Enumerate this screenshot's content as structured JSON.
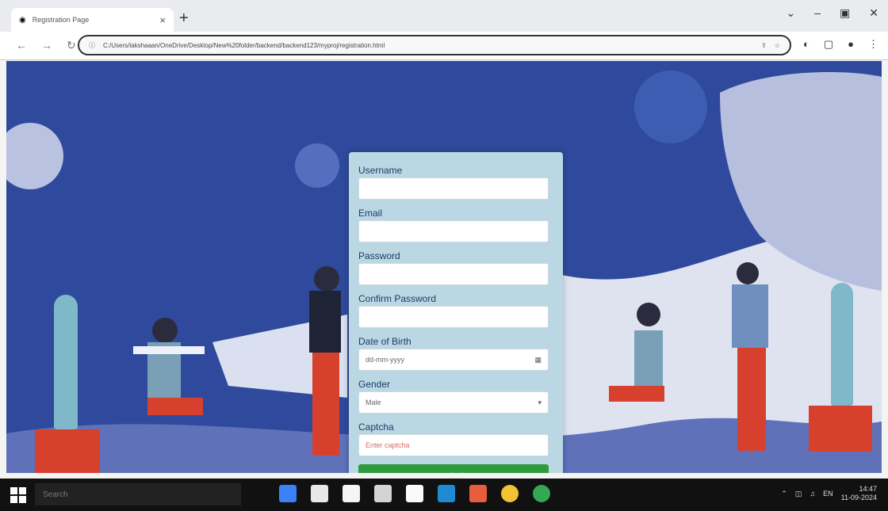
{
  "browser": {
    "tab_title": "Registration Page",
    "tab_close": "×",
    "new_tab": "+",
    "url": "C:/Users/lakshaaan/OneDrive/Desktop/New%20folder/backend/backend123/myproj/registration.html",
    "back": "←",
    "forward": "→",
    "reload": "↻"
  },
  "form": {
    "labels": [
      "Username",
      "Email",
      "Password",
      "Confirm Password",
      "Date of Birth",
      "Gender",
      "Captcha"
    ],
    "date_value": "dd-mm-yyyy",
    "gender_value": "Male",
    "captcha_placeholder": "Enter captcha",
    "submit_label": "Submit"
  },
  "taskbar": {
    "search_placeholder": "Search",
    "time": "14:47",
    "date": "11-09-2024"
  }
}
